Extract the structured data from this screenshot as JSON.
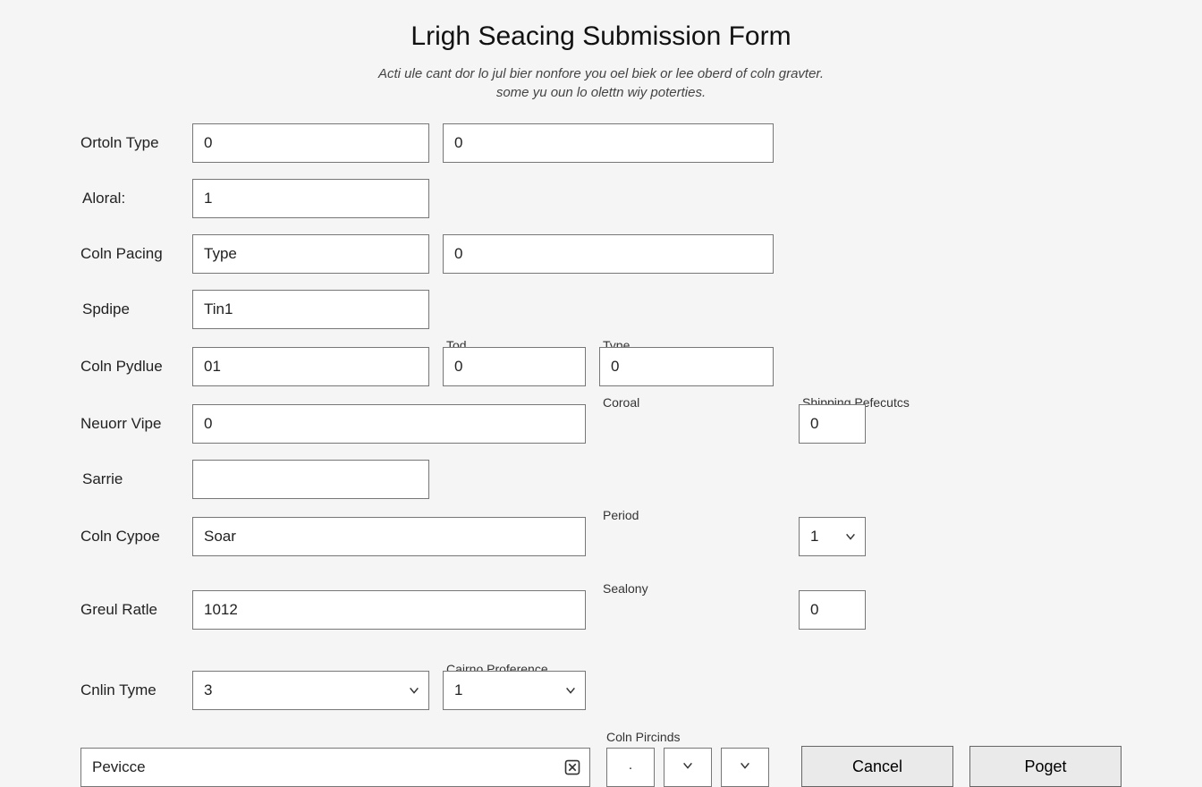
{
  "header": {
    "title": "Lrigh Seacing Submission Form",
    "subtitle_line1": "Acti ule cant dor lo jul bier nonfore you oel biek or lee oberd of coln gravter.",
    "subtitle_line2": "some yu oun lo olettn wiy poterties."
  },
  "row1": {
    "label": "Ortoln Type",
    "value_a": "0",
    "value_b": "0",
    "label_right": "Aloral:",
    "value_right": "1"
  },
  "row2": {
    "label": "Coln Pacing",
    "value_a": "Type",
    "value_b": "0",
    "label_right": "Spdipe",
    "value_right": "Tin1"
  },
  "row3": {
    "label": "Coln Pydlue",
    "value_a": "01",
    "sub_b": "Tod",
    "value_b": "0",
    "sub_c": "Type",
    "value_c": "0"
  },
  "row4": {
    "label": "Neuorr Vipe",
    "value_a": "0",
    "sub_b": "Coroal",
    "value_b": "0",
    "section_right": "Shipping Pefecutcs",
    "label_right": "Sarrie",
    "value_right": ""
  },
  "row5": {
    "label": "Coln Cypoe",
    "value_a": "Soar",
    "sub_b": "Period",
    "value_b": "1"
  },
  "row6": {
    "label": "Greul Ratle",
    "value_a": "1012",
    "sub_b": "Sealony",
    "value_b": "0"
  },
  "row7": {
    "label": "Cnlin Tyme",
    "value_a": "3",
    "sub_b": "Cairno Proference",
    "value_b": "1"
  },
  "bottom": {
    "search_value": "Pevicce",
    "coin_purch_label": "Coln Pircinds",
    "box1": "·",
    "cancel": "Cancel",
    "submit": "Poget"
  }
}
